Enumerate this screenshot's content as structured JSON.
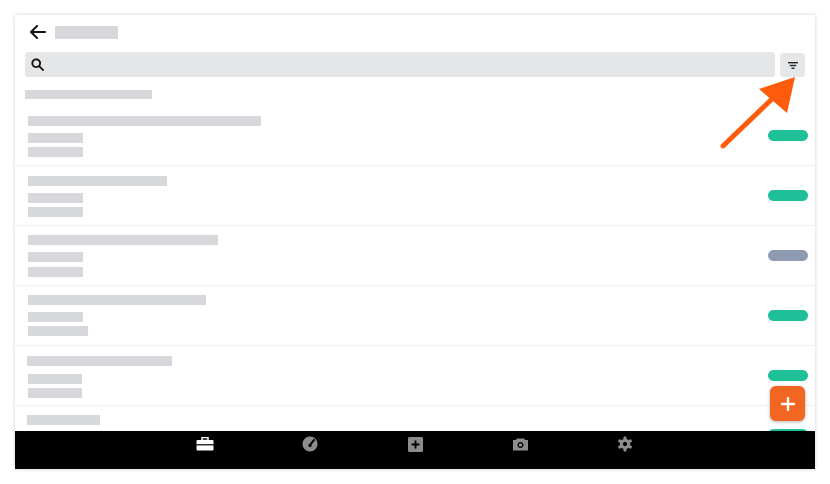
{
  "header": {
    "back_icon": "arrow-left-icon"
  },
  "search": {
    "icon": "search-icon",
    "value": "",
    "placeholder": ""
  },
  "filter": {
    "icon": "filter-icon"
  },
  "list": {
    "rows": [
      {
        "status_color": "#1fbf98"
      },
      {
        "status_color": "#1fbf98"
      },
      {
        "status_color": "#8f9bb3"
      },
      {
        "status_color": "#1fbf98"
      },
      {
        "status_color": "#1fbf98"
      },
      {
        "status_color": "#1fbf98"
      }
    ]
  },
  "fab": {
    "icon": "plus-icon"
  },
  "bottom_nav": {
    "items": [
      {
        "icon": "briefcase-icon"
      },
      {
        "icon": "speedometer-icon"
      },
      {
        "icon": "add-box-icon"
      },
      {
        "icon": "camera-icon"
      },
      {
        "icon": "gear-icon"
      }
    ]
  },
  "colors": {
    "accent": "#f26522",
    "status_active": "#1fbf98",
    "status_inactive": "#8f9bb3",
    "nav_background": "#000000",
    "nav_icon": "#8c8c8c",
    "placeholder": "#d7d8db"
  }
}
